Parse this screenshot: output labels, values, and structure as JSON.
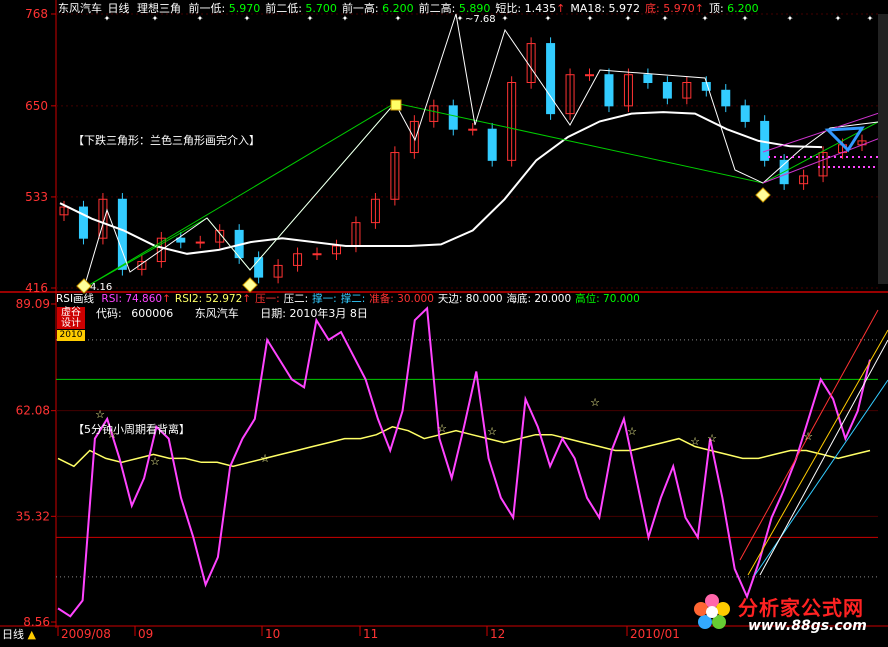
{
  "header": {
    "stock_name": "东风汽车",
    "period": "日线",
    "indicator": "理想三角",
    "items": [
      {
        "label": "前一低:",
        "value": "5.970",
        "color": "#ffffff",
        "vcolor": "#00ff00"
      },
      {
        "label": "前二低:",
        "value": "5.700",
        "color": "#ffffff",
        "vcolor": "#00ff00"
      },
      {
        "label": "前一高:",
        "value": "6.200",
        "color": "#ffffff",
        "vcolor": "#00ff00"
      },
      {
        "label": "前二高:",
        "value": "5.890",
        "color": "#ffffff",
        "vcolor": "#00ff00"
      },
      {
        "label": "短比:",
        "value": "1.435",
        "color": "#ffffff",
        "vcolor": "#ffffff",
        "arrow": "↑"
      },
      {
        "label": "MA18:",
        "value": "5.972",
        "color": "#ffffff",
        "vcolor": "#ffffff"
      },
      {
        "label": "底:",
        "value": "5.970",
        "color": "#ff3333",
        "vcolor": "#ff3333",
        "arrow": "↑"
      },
      {
        "label": "顶:",
        "value": "6.200",
        "color": "#ffffff",
        "vcolor": "#00ff00"
      }
    ]
  },
  "price_panel": {
    "annotation": "【下跌三角形：兰色三角形画完介入】",
    "high_label": "7.68",
    "low_label": "4.16",
    "y_ticks": [
      "768",
      "650",
      "533",
      "416"
    ]
  },
  "rsi_panel": {
    "title": "RSI画线",
    "params": [
      {
        "label": "RSI:",
        "value": "74.860",
        "arrow": "↑",
        "color": "#ff44ff"
      },
      {
        "label": "RSI2:",
        "value": "52.972",
        "arrow": "↑",
        "color": "#ffff66"
      },
      {
        "label": "压一:",
        "value": "",
        "color": "#ff3333"
      },
      {
        "label": "压二:",
        "value": "",
        "color": "#ffffff"
      },
      {
        "label": "撑一:",
        "value": "",
        "color": "#33ccff"
      },
      {
        "label": "撑二:",
        "value": "",
        "color": "#33ccff"
      },
      {
        "label": "准备:",
        "value": "30.000",
        "color": "#ff3333"
      },
      {
        "label": "天边:",
        "value": "80.000",
        "color": "#ffffff"
      },
      {
        "label": "海底:",
        "value": "20.000",
        "color": "#ffffff"
      },
      {
        "label": "高位:",
        "value": "70.000",
        "color": "#00ff00"
      }
    ],
    "code_label": "代码:",
    "code": "600006",
    "name": "东风汽车",
    "date_label": "日期:",
    "date": "2010年3月 8日",
    "annotation": "【5分钟小周期看背离】",
    "badge_line1": "虚谷",
    "badge_line2": "设计",
    "badge_year": "2010",
    "y_ticks": [
      "89.09",
      "62.08",
      "35.32",
      "8.56"
    ]
  },
  "x_axis": {
    "period_label": "日线",
    "labels": [
      "2009/08",
      "09",
      "10",
      "11",
      "12",
      "2010/01"
    ]
  },
  "watermark": {
    "site": "分析家公式网",
    "url": "www.88gs.com"
  },
  "colors": {
    "background": "#000000",
    "up_candle": "#ff3333",
    "down_candle": "#33ccff",
    "ma_line": "#ffffff",
    "rsi_line": "#ff44ff",
    "rsi2_line": "#ffff66",
    "triangle_line": "#00cc00",
    "axis": "#cc0000",
    "high_level": "#00cc00",
    "prepare_level": "#cc0000"
  },
  "chart_data": [
    {
      "type": "candlestick",
      "title": "东风汽车 日线 理想三角",
      "ylim": [
        4.16,
        7.68
      ],
      "y_ticks": [
        7.68,
        6.5,
        5.33,
        4.16
      ],
      "x_labels": [
        "2009/08",
        "09",
        "10",
        "11",
        "12",
        "2010/01"
      ],
      "series": [
        {
          "name": "MA18",
          "values": [
            5.25,
            5.05,
            4.9,
            4.7,
            4.6,
            4.65,
            4.75,
            4.8,
            4.75,
            4.7,
            4.7,
            4.7,
            4.72,
            4.9,
            5.3,
            5.8,
            6.1,
            6.3,
            6.4,
            6.42,
            6.4,
            6.2,
            6.05,
            5.98,
            5.97
          ]
        }
      ],
      "close": [
        5.2,
        4.8,
        5.3,
        4.4,
        4.5,
        4.8,
        4.75,
        4.75,
        4.9,
        4.55,
        4.3,
        4.45,
        4.6,
        4.6,
        4.7,
        5.0,
        5.3,
        5.9,
        6.3,
        6.5,
        6.2,
        6.2,
        5.8,
        6.8,
        7.3,
        6.4,
        6.9,
        6.9,
        6.5,
        6.9,
        6.8,
        6.6,
        6.8,
        6.7,
        6.5,
        6.3,
        5.8,
        5.5,
        5.6,
        5.9,
        6.0,
        6.05
      ],
      "annotations": [
        "7.68",
        "4.16"
      ]
    },
    {
      "type": "line",
      "title": "RSI画线",
      "ylim": [
        8.56,
        89.09
      ],
      "y_ticks": [
        89.09,
        62.08,
        35.32,
        8.56
      ],
      "levels": {
        "高位": 70.0,
        "准备": 30.0,
        "天边": 80.0,
        "海底": 20.0
      },
      "series": [
        {
          "name": "RSI",
          "values": [
            12,
            10,
            14,
            55,
            60,
            50,
            38,
            45,
            58,
            55,
            40,
            30,
            18,
            25,
            48,
            55,
            60,
            80,
            75,
            70,
            68,
            85,
            80,
            82,
            76,
            70,
            60,
            52,
            62,
            85,
            88,
            55,
            45,
            58,
            72,
            50,
            40,
            35,
            65,
            58,
            48,
            55,
            50,
            40,
            35,
            52,
            60,
            45,
            30,
            40,
            48,
            35,
            30,
            55,
            40,
            22,
            15,
            24,
            35,
            42,
            50,
            60,
            70,
            65,
            55,
            62,
            75
          ]
        },
        {
          "name": "RSI2",
          "values": [
            50,
            48,
            52,
            50,
            49,
            50,
            51,
            50,
            50,
            49,
            49,
            48,
            49,
            50,
            51,
            52,
            53,
            54,
            55,
            55,
            56,
            58,
            57,
            55,
            56,
            57,
            56,
            55,
            54,
            55,
            56,
            56,
            55,
            54,
            53,
            52,
            52,
            53,
            54,
            55,
            53,
            52,
            51,
            50,
            50,
            51,
            52,
            52,
            51,
            50,
            51,
            52
          ]
        }
      ]
    }
  ]
}
